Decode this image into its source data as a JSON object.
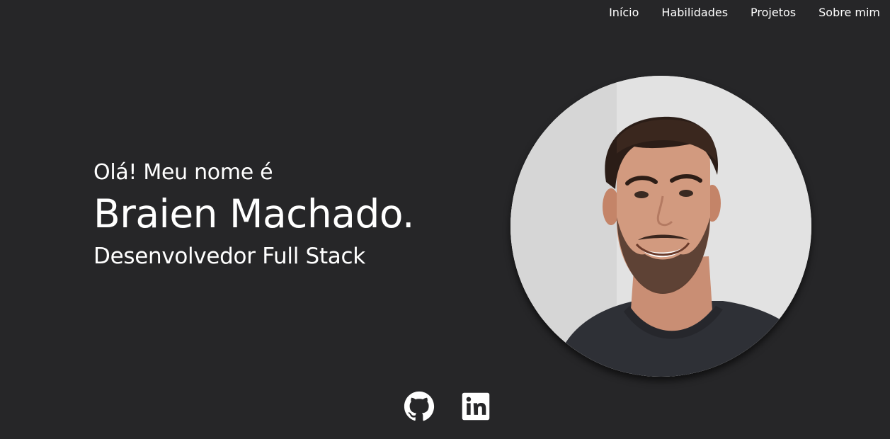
{
  "nav": {
    "items": [
      {
        "label": "Início"
      },
      {
        "label": "Habilidades"
      },
      {
        "label": "Projetos"
      },
      {
        "label": "Sobre mim"
      }
    ]
  },
  "hero": {
    "greeting": "Olá! Meu nome é",
    "name": "Braien Machado.",
    "role": "Desenvolvedor Full Stack"
  },
  "social": {
    "icons": [
      "github-icon",
      "linkedin-icon"
    ]
  },
  "colors": {
    "background": "#262628",
    "text": "#ffffff"
  }
}
